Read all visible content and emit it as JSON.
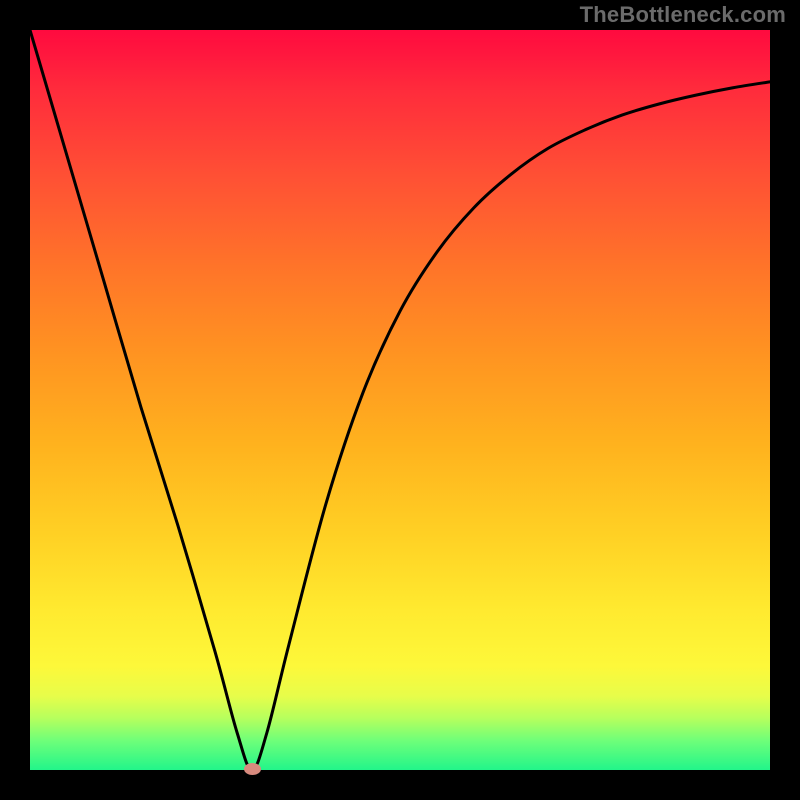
{
  "watermark": "TheBottleneck.com",
  "colors": {
    "page_bg": "#000000",
    "curve": "#000000",
    "dot": "#d88a7e",
    "gradient_top": "#ff0a3f",
    "gradient_bottom": "#22f58a"
  },
  "chart_data": {
    "type": "line",
    "title": "",
    "xlabel": "",
    "ylabel": "",
    "xlim": [
      0,
      100
    ],
    "ylim": [
      0,
      100
    ],
    "grid": false,
    "series": [
      {
        "name": "bottleneck-curve",
        "x": [
          0,
          5,
          10,
          15,
          20,
          25,
          28,
          30,
          32,
          35,
          40,
          45,
          50,
          55,
          60,
          65,
          70,
          75,
          80,
          85,
          90,
          95,
          100
        ],
        "y": [
          100,
          83,
          66,
          49,
          33,
          16,
          5,
          0,
          5,
          17,
          36,
          51,
          62,
          70,
          76,
          80.5,
          84,
          86.5,
          88.5,
          90,
          91.2,
          92.2,
          93
        ]
      }
    ],
    "marker": {
      "x": 30,
      "y": 0,
      "name": "minimum-dot"
    },
    "background": {
      "type": "vertical-gradient",
      "description": "red (top, high bottleneck) to green (bottom, low bottleneck)",
      "stops": [
        {
          "pos": 0.0,
          "color": "#ff0a3f"
        },
        {
          "pos": 0.2,
          "color": "#ff5134"
        },
        {
          "pos": 0.44,
          "color": "#ff9421"
        },
        {
          "pos": 0.68,
          "color": "#ffd024"
        },
        {
          "pos": 0.86,
          "color": "#fdf83a"
        },
        {
          "pos": 0.96,
          "color": "#6fff79"
        },
        {
          "pos": 1.0,
          "color": "#22f58a"
        }
      ]
    }
  }
}
